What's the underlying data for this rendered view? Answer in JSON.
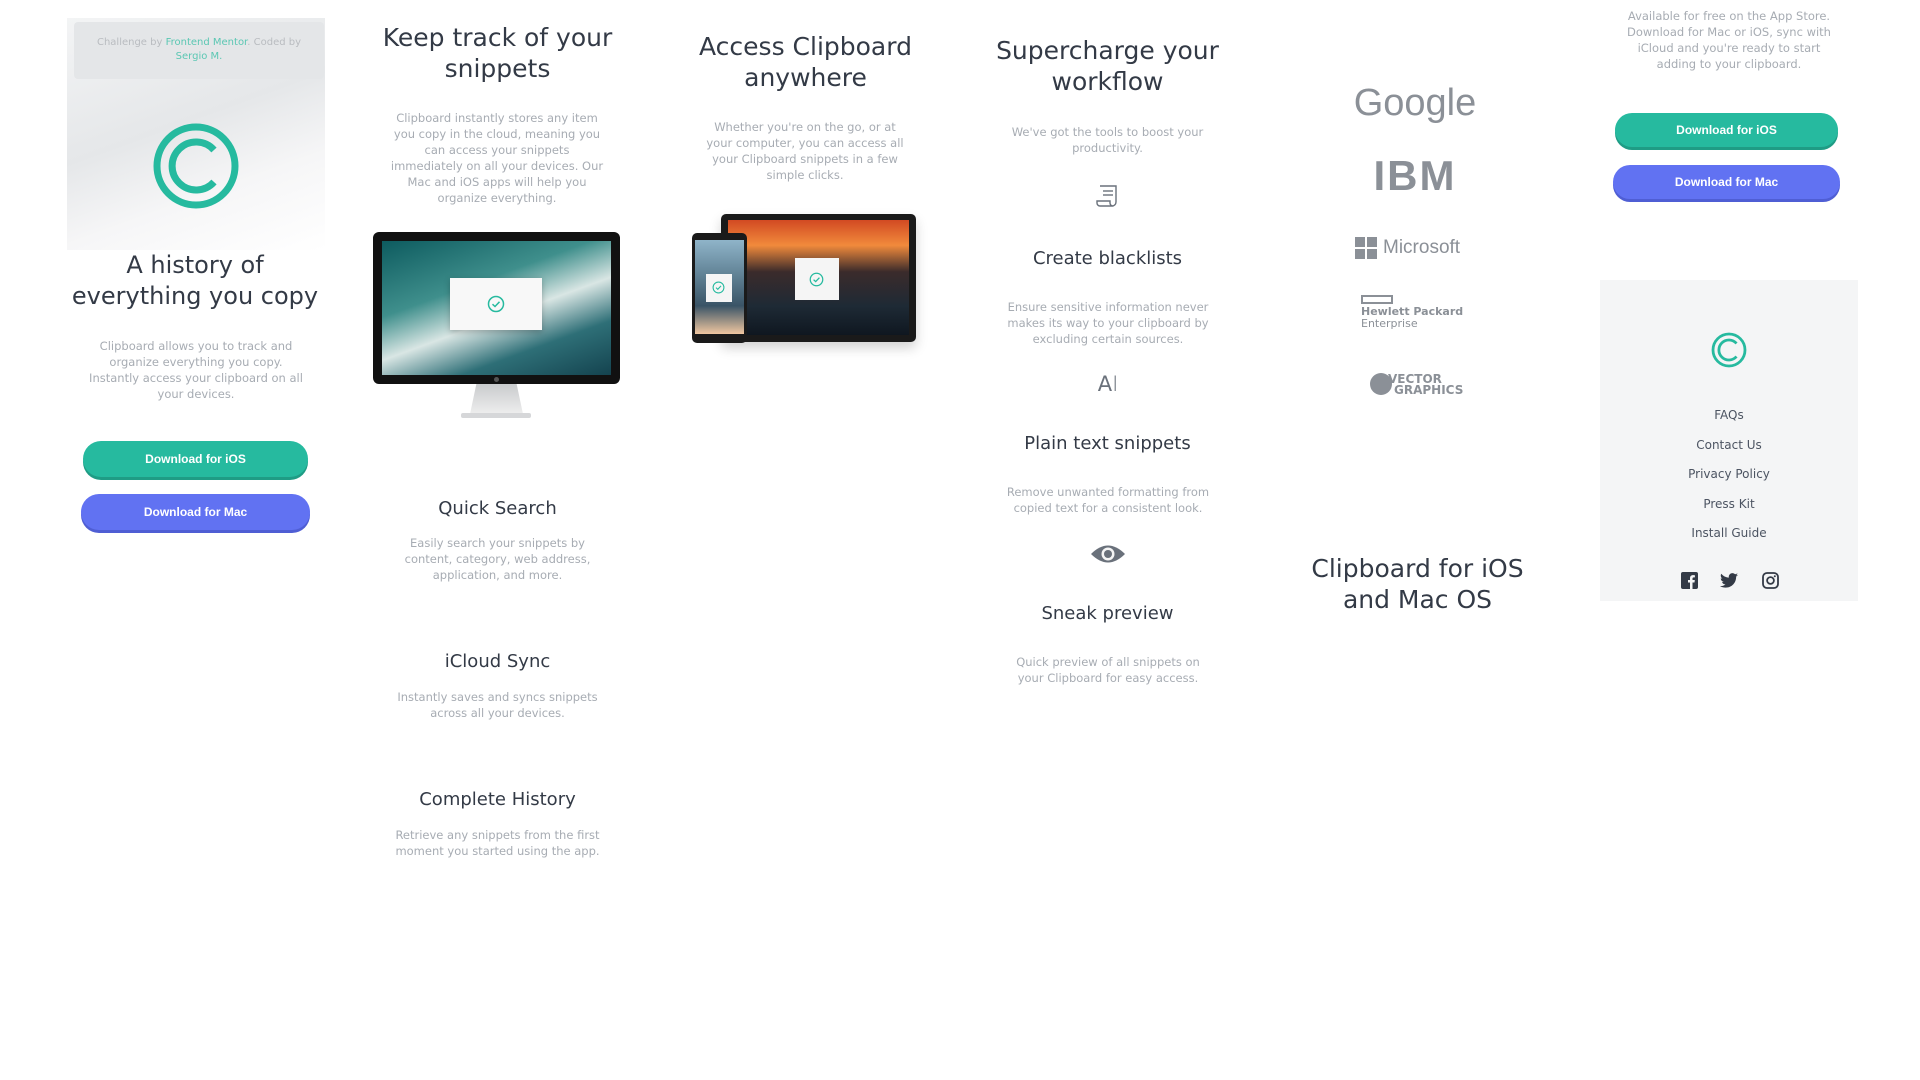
{
  "hero": {
    "attribution": {
      "prefix": "Challenge by ",
      "challenge_link": "Frontend Mentor",
      "middle": ". Coded by ",
      "author_link": "Sergio M."
    },
    "title": "A history of everything you copy",
    "description": "Clipboard allows you to track and organize everything you copy. Instantly access your clipboard on all your devices.",
    "ios_button": "Download for iOS",
    "mac_button": "Download for Mac"
  },
  "snippets": {
    "title": "Keep track of your snippets",
    "description": "Clipboard instantly stores any item you copy in the cloud, meaning you can access your snippets immediately on all your devices. Our Mac and iOS apps will help you organize everything.",
    "features": [
      {
        "title": "Quick Search",
        "description": "Easily search your snippets by content, category, web address, application, and more."
      },
      {
        "title": "iCloud Sync",
        "description": "Instantly saves and syncs snippets across all your devices."
      },
      {
        "title": "Complete History",
        "description": "Retrieve any snippets from the first moment you started using the app."
      }
    ]
  },
  "access": {
    "title": "Access Clipboard anywhere",
    "description": "Whether you're on the go, or at your computer, you can access all your Clipboard snippets in a few simple clicks."
  },
  "workflow": {
    "title": "Supercharge your workflow",
    "description": "We've got the tools to boost your productivity.",
    "features": [
      {
        "icon": "blacklist-icon",
        "title": "Create blacklists",
        "description": "Ensure sensitive information never makes its way to your clipboard by excluding certain sources."
      },
      {
        "icon": "text-icon",
        "title": "Plain text snippets",
        "description": "Remove unwanted formatting from copied text for a consistent look."
      },
      {
        "icon": "eye-icon",
        "title": "Sneak preview",
        "description": "Quick preview of all snippets on your Clipboard for easy access."
      }
    ]
  },
  "partners": {
    "logos": [
      "Google",
      "IBM",
      "Microsoft",
      "Hewlett Packard",
      "Enterprise",
      "VECTOR",
      "GRAPHICS"
    ]
  },
  "cta": {
    "title": "Clipboard for iOS and Mac OS",
    "top_text": "Available for free on the App Store. Download for Mac or iOS, sync with iCloud and you're ready to start adding to your clipboard.",
    "ios_button": "Download for iOS",
    "mac_button": "Download for Mac"
  },
  "footer": {
    "links": [
      "FAQs",
      "Contact Us",
      "Privacy Policy",
      "Press Kit",
      "Install Guide"
    ],
    "social": [
      "facebook-icon",
      "twitter-icon",
      "instagram-icon"
    ]
  },
  "colors": {
    "accent_green": "#26ba9f",
    "accent_blue": "#6172f2",
    "heading": "#333a46",
    "muted": "#a7acb3"
  }
}
